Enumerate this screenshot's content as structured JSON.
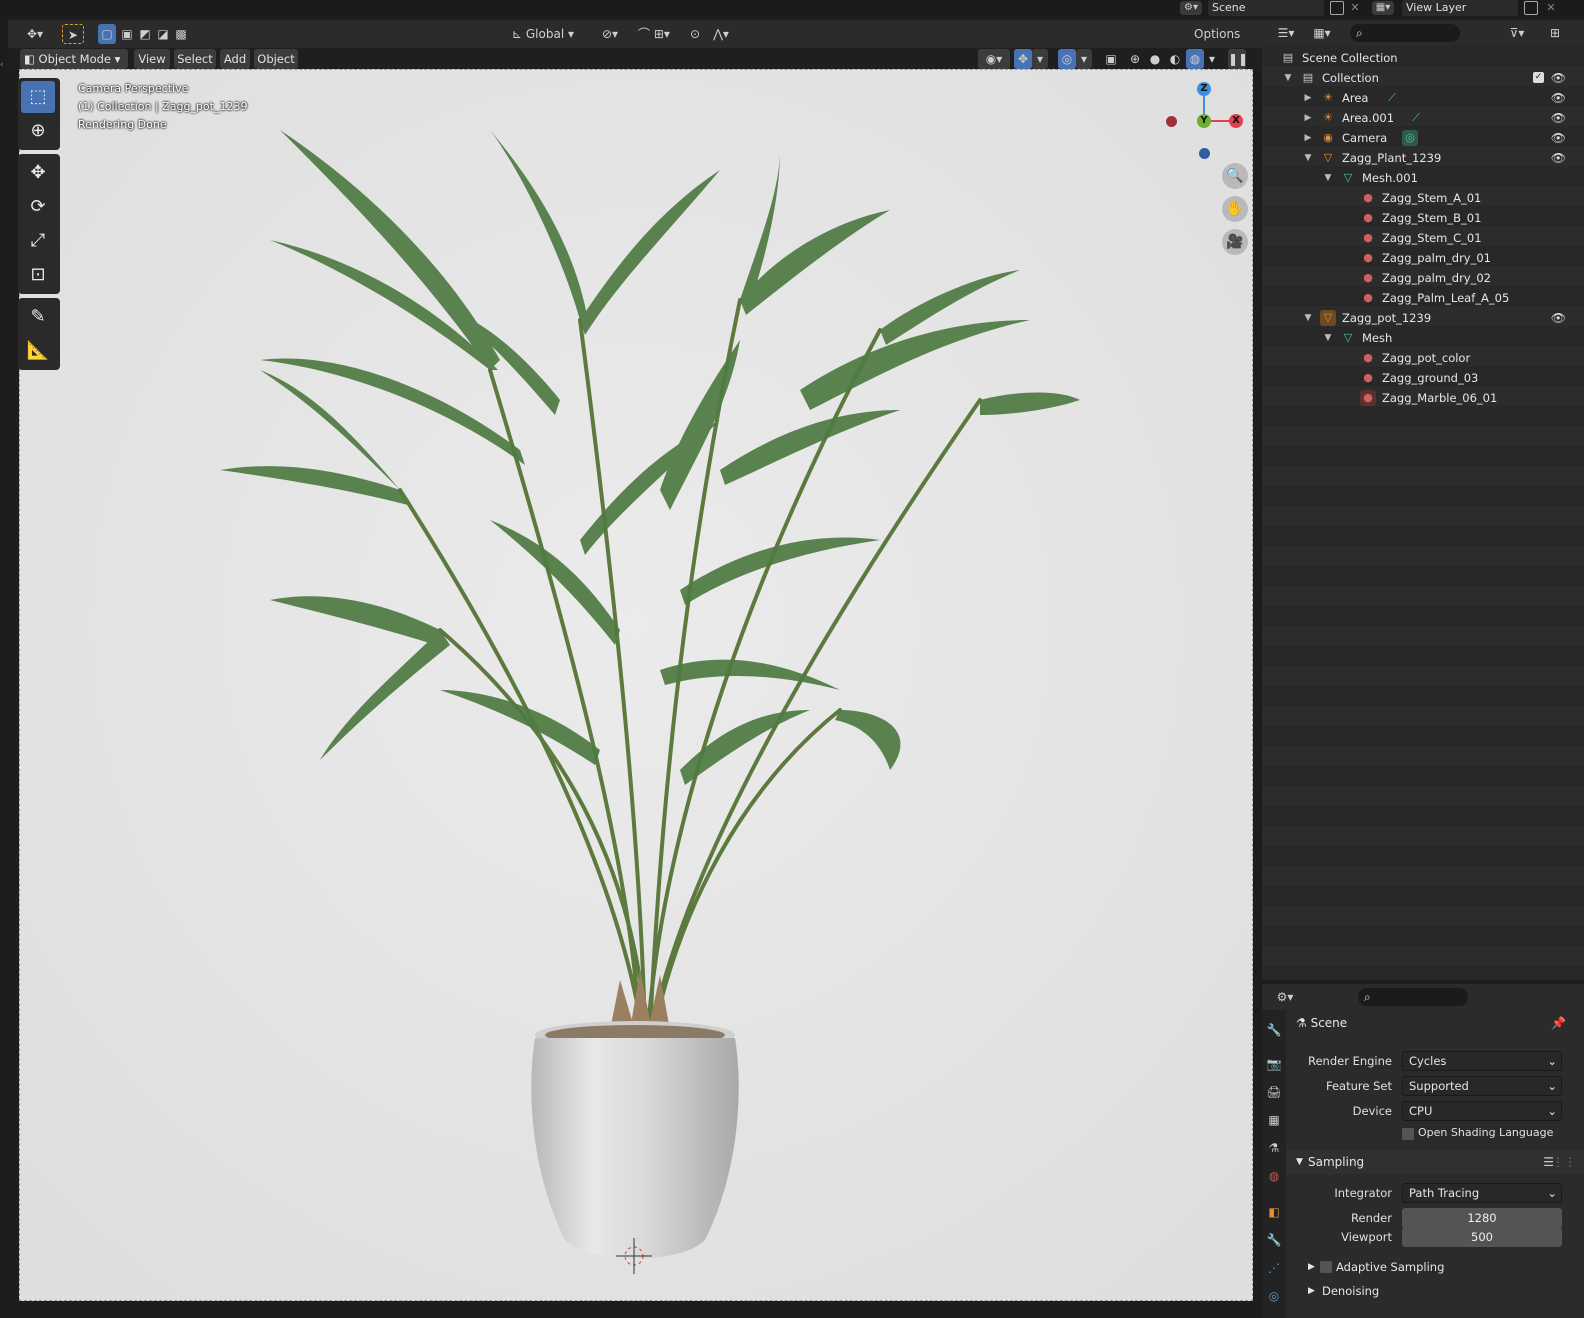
{
  "top_bar": {
    "scene_label": "Scene",
    "view_layer_label": "View Layer"
  },
  "viewport_header": {
    "transform_orientation": "Global",
    "options_label": "Options",
    "mode_label": "Object Mode",
    "menus": [
      "View",
      "Select",
      "Add",
      "Object"
    ]
  },
  "viewport": {
    "overlay_lines": [
      "Camera Perspective",
      "(1) Collection | Zagg_pot_1239",
      "Rendering Done"
    ],
    "gizmo": {
      "z": "Z",
      "y": "Y",
      "x": "X"
    }
  },
  "outliner": {
    "items": [
      {
        "label": "Scene Collection",
        "icon": "scene-collection-icon",
        "icon_glyph": "▤",
        "color": "#c8c8c8"
      },
      {
        "label": "Collection",
        "icon": "collection-icon",
        "icon_glyph": "▤",
        "color": "#c8c8c8"
      },
      {
        "label": "Area",
        "icon": "light-icon",
        "icon_glyph": "💡",
        "color": "#e08c3c"
      },
      {
        "label": "Area.001",
        "icon": "light-icon",
        "icon_glyph": "💡",
        "color": "#e08c3c"
      },
      {
        "label": "Camera",
        "icon": "camera-icon",
        "icon_glyph": "🎥",
        "color": "#e08c3c"
      },
      {
        "label": "Zagg_Plant_1239",
        "icon": "mesh-object-icon",
        "icon_glyph": "▽",
        "color": "#e08c3c"
      },
      {
        "label": "Mesh.001",
        "icon": "mesh-data-icon",
        "icon_glyph": "▽",
        "color": "#4fc3a0"
      },
      {
        "label": "Zagg_Stem_A_01",
        "icon": "material-icon",
        "icon_glyph": "●",
        "color": "#d06060"
      },
      {
        "label": "Zagg_Stem_B_01",
        "icon": "material-icon",
        "icon_glyph": "●",
        "color": "#d06060"
      },
      {
        "label": "Zagg_Stem_C_01",
        "icon": "material-icon",
        "icon_glyph": "●",
        "color": "#d06060"
      },
      {
        "label": "Zagg_palm_dry_01",
        "icon": "material-icon",
        "icon_glyph": "●",
        "color": "#d06060"
      },
      {
        "label": "Zagg_palm_dry_02",
        "icon": "material-icon",
        "icon_glyph": "●",
        "color": "#d06060"
      },
      {
        "label": "Zagg_Palm_Leaf_A_05",
        "icon": "material-icon",
        "icon_glyph": "●",
        "color": "#d06060"
      },
      {
        "label": "Zagg_pot_1239",
        "icon": "mesh-object-icon",
        "icon_glyph": "▽",
        "color": "#e08c3c"
      },
      {
        "label": "Mesh",
        "icon": "mesh-data-icon",
        "icon_glyph": "▽",
        "color": "#4fc3a0"
      },
      {
        "label": "Zagg_pot_color",
        "icon": "material-icon",
        "icon_glyph": "●",
        "color": "#d06060"
      },
      {
        "label": "Zagg_ground_03",
        "icon": "material-icon",
        "icon_glyph": "●",
        "color": "#d06060"
      },
      {
        "label": "Zagg_Marble_06_01",
        "icon": "material-icon",
        "icon_glyph": "●",
        "color": "#d06060"
      }
    ]
  },
  "properties": {
    "context_label": "Scene",
    "render_engine": {
      "label": "Render Engine",
      "value": "Cycles"
    },
    "feature_set": {
      "label": "Feature Set",
      "value": "Supported"
    },
    "device": {
      "label": "Device",
      "value": "CPU"
    },
    "osl_label": "Open Shading Language",
    "sampling": {
      "title": "Sampling",
      "integrator": {
        "label": "Integrator",
        "value": "Path Tracing"
      },
      "render": {
        "label": "Render",
        "value": "1280"
      },
      "viewport": {
        "label": "Viewport",
        "value": "500"
      }
    },
    "adaptive_sampling_label": "Adaptive Sampling",
    "denoising_label": "Denoising"
  },
  "colors": {
    "accent": "#4772b3",
    "header_bg": "#2b2b2b",
    "viewport_bg": "#e6e6e6",
    "axis_x": "#e04050",
    "axis_y": "#6ab02c",
    "axis_z": "#3c8ee0"
  }
}
